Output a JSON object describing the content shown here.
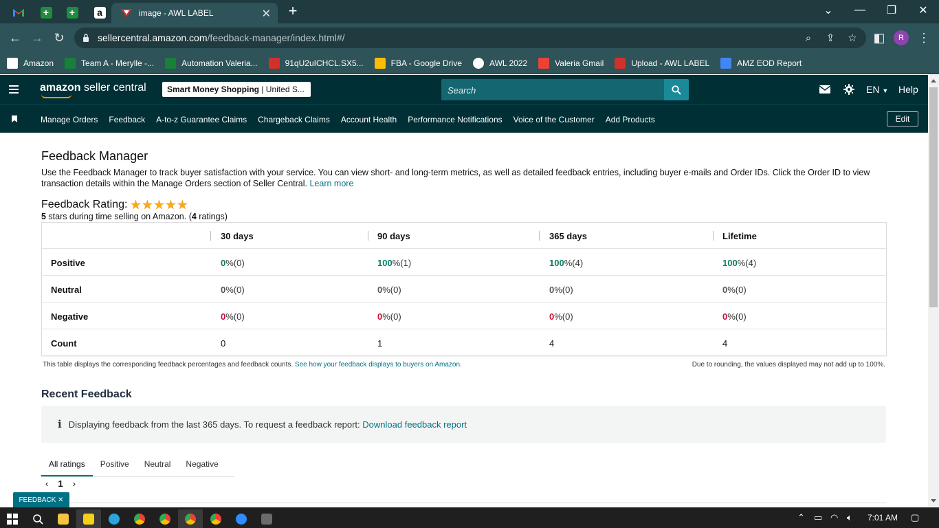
{
  "browser": {
    "tab_title": "image - AWL LABEL",
    "url_host": "sellercentral.amazon.com",
    "url_path": "/feedback-manager/index.html#/",
    "profile_initial": "R",
    "bookmarks": [
      {
        "label": "Amazon",
        "icon": "amazon-icon",
        "color": "#ffffff"
      },
      {
        "label": "Team A - Merylle -...",
        "icon": "sheets-icon",
        "color": "#188038"
      },
      {
        "label": "Automation Valeria...",
        "icon": "sheets-icon",
        "color": "#188038"
      },
      {
        "label": "91qU2uICHCL.SX5...",
        "icon": "awl-icon",
        "color": "#d0312d"
      },
      {
        "label": "FBA - Google Drive",
        "icon": "drive-icon",
        "color": "#fbbc04"
      },
      {
        "label": "AWL 2022",
        "icon": "globe-icon",
        "color": "#ffffff"
      },
      {
        "label": "Valeria Gmail",
        "icon": "gmail-icon",
        "color": "#ea4335"
      },
      {
        "label": "Upload - AWL LABEL",
        "icon": "awl-icon",
        "color": "#d0312d"
      },
      {
        "label": "AMZ EOD Report",
        "icon": "report-icon",
        "color": "#4285f4"
      }
    ]
  },
  "header": {
    "logo_bold": "amazon",
    "logo_rest": " seller central",
    "store_bold": "Smart Money Shopping",
    "store_rest": " | United S...",
    "search_placeholder": "Search",
    "lang": "EN",
    "help": "Help"
  },
  "nav": {
    "items": [
      "Manage Orders",
      "Feedback",
      "A-to-z Guarantee Claims",
      "Chargeback Claims",
      "Account Health",
      "Performance Notifications",
      "Voice of the Customer",
      "Add Products"
    ],
    "edit": "Edit"
  },
  "page": {
    "title": "Feedback Manager",
    "description": "Use the Feedback Manager to track buyer satisfaction with your service. You can view short- and long-term metrics, as well as detailed feedback entries, including buyer e-mails and Order IDs. Click the Order ID to view transaction details within the Manage Orders section of Seller Central.",
    "learn_more": "Learn more",
    "rating_title": "Feedback Rating:",
    "stars": 5,
    "rating_stars_num": "5",
    "rating_sub_a": " stars during time selling on Amazon. (",
    "rating_count": "4",
    "rating_sub_b": " ratings)"
  },
  "table": {
    "headers": [
      "30 days",
      "90 days",
      "365 days",
      "Lifetime"
    ],
    "rows": [
      {
        "label": "Positive",
        "values": [
          [
            "0",
            " %(0)"
          ],
          [
            "100",
            " %(1)"
          ],
          [
            "100",
            " %(4)"
          ],
          [
            "100",
            " %(4)"
          ]
        ]
      },
      {
        "label": "Neutral",
        "values": [
          [
            "0",
            " %(0)"
          ],
          [
            "0",
            " %(0)"
          ],
          [
            "0",
            " %(0)"
          ],
          [
            "0",
            " %(0)"
          ]
        ]
      },
      {
        "label": "Negative",
        "values": [
          [
            "0",
            " %(0)"
          ],
          [
            "0",
            " %(0)"
          ],
          [
            "0",
            " %(0)"
          ],
          [
            "0",
            " %(0)"
          ]
        ]
      },
      {
        "label": "Count",
        "values": [
          "0",
          "1",
          "4",
          "4"
        ]
      }
    ],
    "note_left": "This table displays the corresponding feedback percentages and feedback counts.",
    "note_link": "See how your feedback displays to buyers on Amazon.",
    "note_right": "Due to rounding, the values displayed may not add up to 100%."
  },
  "recent": {
    "title": "Recent Feedback",
    "info_text": "Displaying feedback from the last 365 days. To request a feedback report:",
    "info_link": "Download feedback report",
    "tabs": [
      "All ratings",
      "Positive",
      "Neutral",
      "Negative"
    ],
    "page": "1"
  },
  "feedback_tab": "FEEDBACK",
  "taskbar": {
    "time": "7:01 AM"
  }
}
